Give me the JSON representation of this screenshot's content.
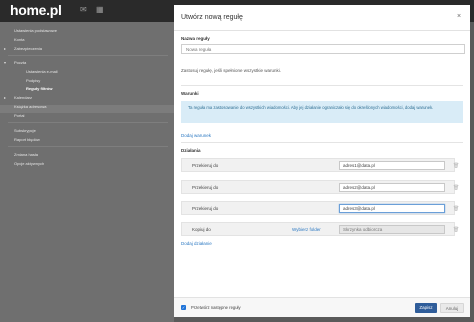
{
  "app": {
    "logo": "home.pl"
  },
  "sidebar": {
    "items": [
      {
        "label": "Ustawienia podstawowe"
      },
      {
        "label": "Konta"
      },
      {
        "label": "Zabezpieczenia"
      },
      {
        "label": "Poczta"
      },
      {
        "label": "Ustawienia e-mail"
      },
      {
        "label": "Podpisy"
      },
      {
        "label": "Reguły filtrów"
      },
      {
        "label": "Kalendarz"
      },
      {
        "label": "Książka adresowa"
      },
      {
        "label": "Portal"
      },
      {
        "label": "Subskrypcje"
      },
      {
        "label": "Raport błędów"
      },
      {
        "label": "Zmiana hasła"
      },
      {
        "label": "Opcje aktywnych"
      }
    ]
  },
  "modal": {
    "title": "Utwórz nową regułę",
    "close": "×",
    "name_label": "Nazwa reguły",
    "name_placeholder": "Nowa reguła",
    "apply_text": "Zastosuj regułę, jeśli spełnione wszystkie warunki.",
    "conditions_label": "Warunki",
    "info_text": "Ta reguła ma zastosowanie do wszystkich wiadomości. Aby jej działanie ograniczało się do określonych wiadomości, dodaj warunek.",
    "add_condition": "Dodaj warunek",
    "actions_label": "Działania",
    "actions": [
      {
        "label": "Przekieruj do",
        "value": "adres1@data.pl"
      },
      {
        "label": "Przekieruj do",
        "value": "adres2@data.pl"
      },
      {
        "label": "Przekieruj do",
        "value": "adres3@data.pl"
      },
      {
        "label": "Kopiuj do",
        "select_folder": "Wybierz folder",
        "value": "Skrzynka odbiorcza"
      }
    ],
    "add_action": "Dodaj działanie",
    "continue_label": "Przetwórz następne reguły",
    "save": "Zapisz",
    "cancel": "Anuluj"
  }
}
